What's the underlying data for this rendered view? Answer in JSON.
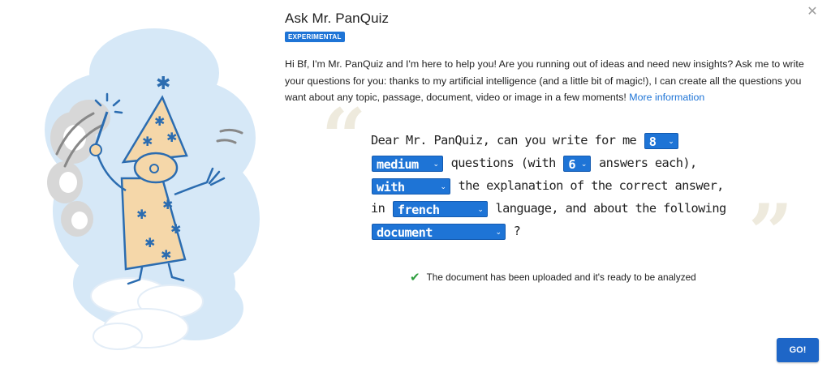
{
  "dialog": {
    "title": "Ask Mr. PanQuiz",
    "badge": "EXPERIMENTAL",
    "close_label": "✕",
    "intro": "Hi Bf, I'm Mr. PanQuiz and I'm here to help you! Are you running out of ideas and need new insights? Ask me to write your questions for you: thanks to my artificial intelligence (and a little bit of magic!), I can create all the questions you want about any topic, passage, document, video or image in a few moments!",
    "more_info_link": "More information"
  },
  "prompt": {
    "part1": "Dear Mr. PanQuiz, can you write for me",
    "question_count": "8",
    "difficulty": "medium",
    "part2": "questions (with",
    "answer_count": "6",
    "part3": "answers each),",
    "explanation": "with",
    "part4": "the explanation of the correct answer, in",
    "language": "french",
    "part5": "language, and about the following",
    "source": "document",
    "part6": "?"
  },
  "status": {
    "message": "The document has been uploaded and it's ready to be analyzed"
  },
  "actions": {
    "go_label": "GO!"
  },
  "icons": {
    "close": "close-icon",
    "check": "check-icon",
    "caret": "chevron-down-icon",
    "illustration": "wizard-illustration"
  },
  "colors": {
    "accent": "#1e74d6",
    "button": "#1e66c7",
    "success": "#2e9e3e",
    "quote": "#eeeadd",
    "cloud": "#d6e8f7"
  }
}
